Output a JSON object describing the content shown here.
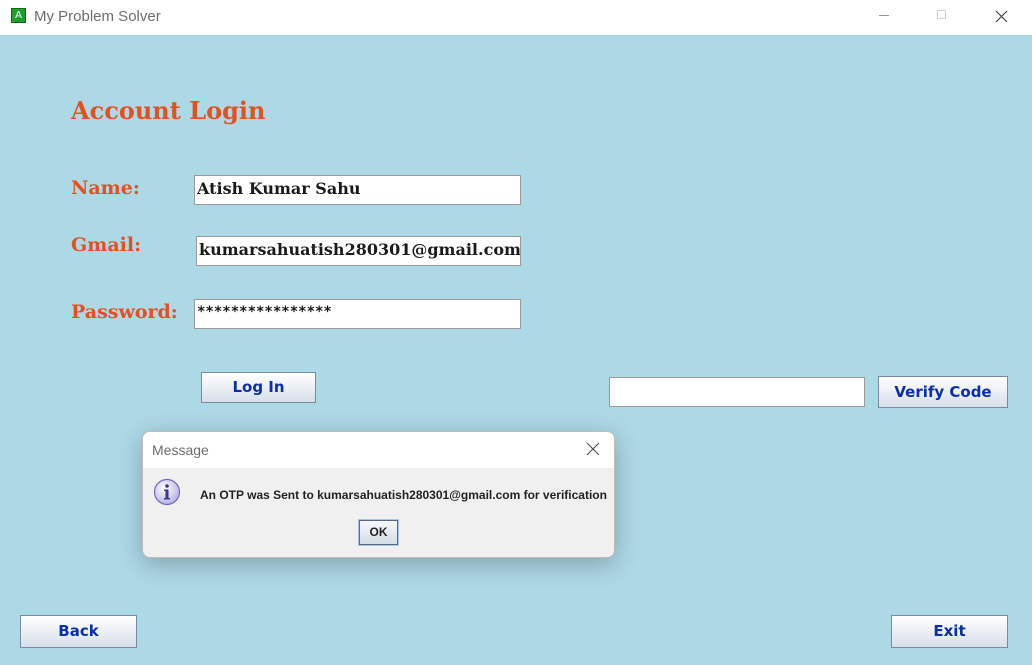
{
  "window": {
    "app_icon_glyph": "A",
    "title": "My Problem Solver"
  },
  "form": {
    "heading": "Account Login",
    "name_label": "Name:",
    "name_value": "Atish Kumar Sahu",
    "gmail_label": "Gmail:",
    "gmail_value": "kumarsahuatish280301@gmail.com",
    "password_label": "Password:",
    "password_value": "****************",
    "login_label": "Log In",
    "code_value": "",
    "verify_label": "Verify Code"
  },
  "dialog": {
    "title": "Message",
    "icon": "info-icon",
    "message": "An OTP was Sent to kumarsahuatish280301@gmail.com for verification",
    "ok_label": "OK"
  },
  "footer": {
    "back_label": "Back",
    "exit_label": "Exit"
  },
  "colors": {
    "background": "#add8e6",
    "label_accent": "#e2511f",
    "button_text": "#0a2fa8"
  }
}
